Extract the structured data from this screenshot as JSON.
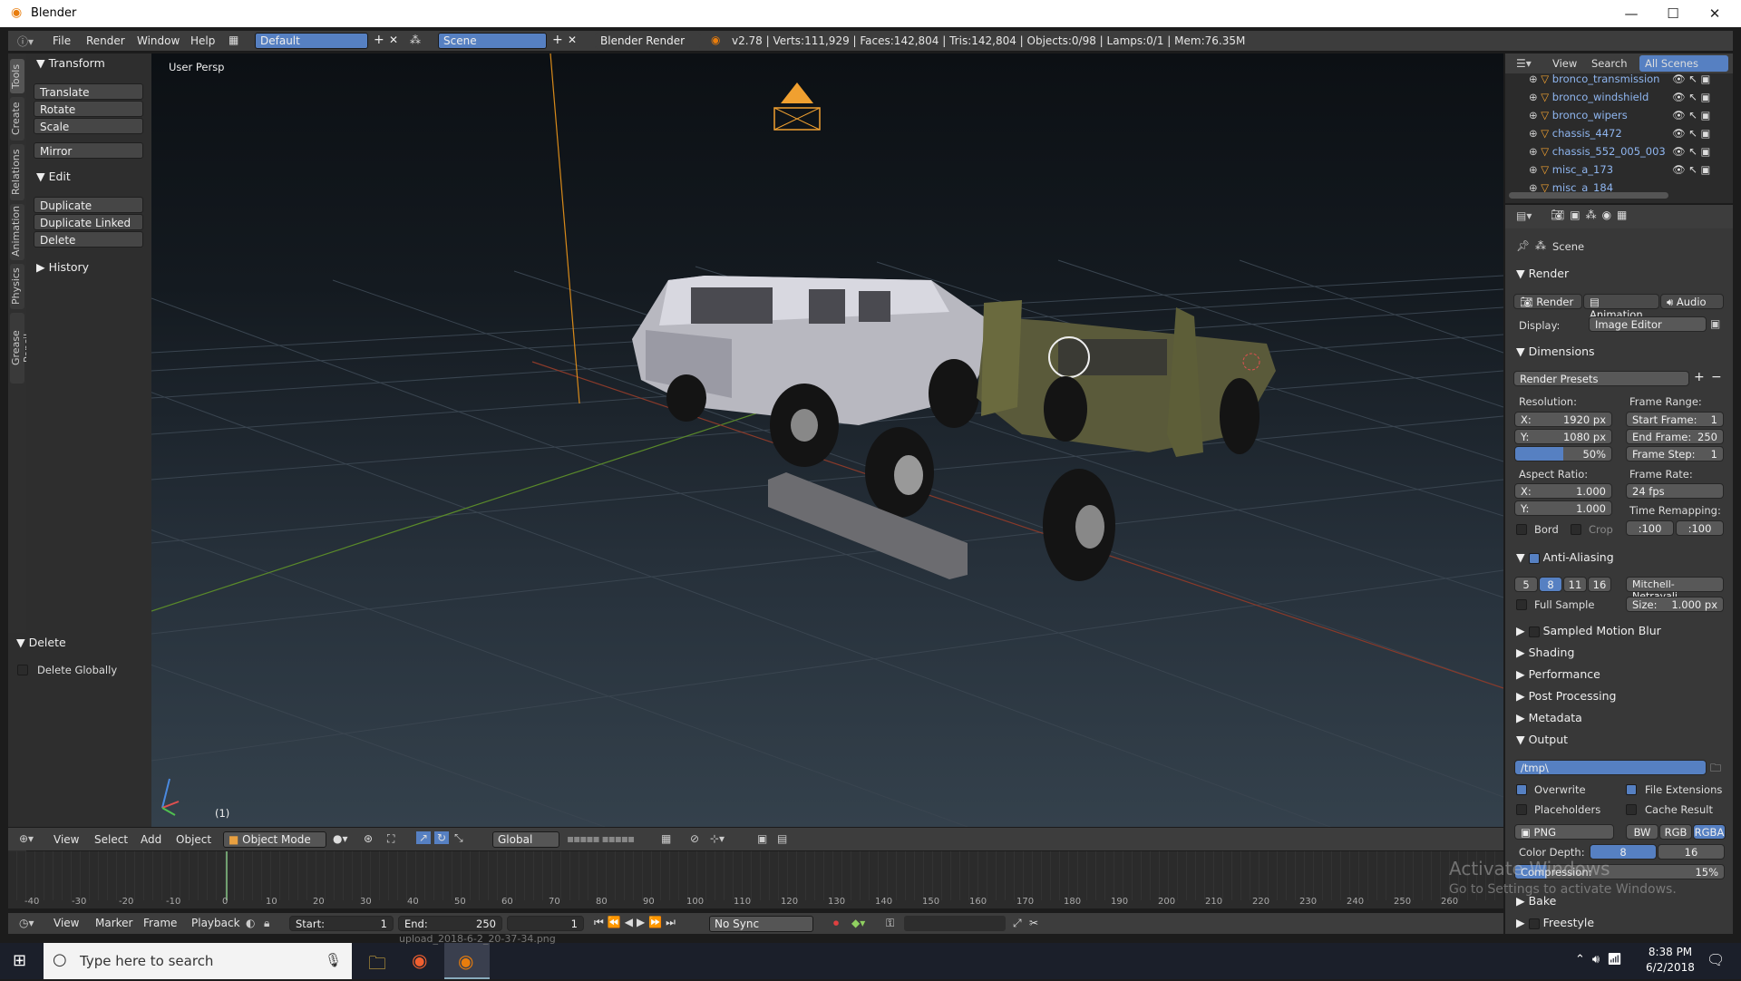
{
  "window": {
    "title": "Blender",
    "minimize": "—",
    "maximize": "☐",
    "close": "✕"
  },
  "infobar": {
    "menus": [
      "File",
      "Render",
      "Window",
      "Help"
    ],
    "layout": "Default",
    "scene": "Scene",
    "engine": "Blender Render",
    "stats": "v2.78 | Verts:111,929 | Faces:142,804 | Tris:142,804 | Objects:0/98 | Lamps:0/1 | Mem:76.35M"
  },
  "vtabs": [
    "Tools",
    "Create",
    "Relations",
    "Animation",
    "Physics",
    "Grease Pencil"
  ],
  "toolshelf": {
    "transform": {
      "header": "Transform",
      "items": [
        "Translate",
        "Rotate",
        "Scale",
        "Mirror"
      ]
    },
    "edit": {
      "header": "Edit",
      "items": [
        "Duplicate",
        "Duplicate Linked",
        "Delete"
      ]
    },
    "history": "History",
    "delete_panel": {
      "header": "Delete",
      "checkbox": "Delete Globally"
    }
  },
  "viewport": {
    "label": "User Persp",
    "frame_label": "(1)"
  },
  "vpheader": {
    "items": [
      "View",
      "Select",
      "Add",
      "Object"
    ],
    "mode": "Object Mode",
    "orientation": "Global"
  },
  "timeline": {
    "ticks": [
      "-40",
      "-30",
      "-20",
      "-10",
      "0",
      "10",
      "20",
      "30",
      "40",
      "50",
      "60",
      "70",
      "80",
      "90",
      "100",
      "110",
      "120",
      "130",
      "140",
      "150",
      "160",
      "170",
      "180",
      "190",
      "200",
      "210",
      "220",
      "230",
      "240",
      "250",
      "260"
    ],
    "menus": [
      "View",
      "Marker",
      "Frame",
      "Playback"
    ],
    "start_label": "Start:",
    "start": "1",
    "end_label": "End:",
    "end": "250",
    "current": "1",
    "sync": "No Sync"
  },
  "outliner": {
    "menus": [
      "View",
      "Search",
      "All Scenes"
    ],
    "rows": [
      "bronco_transmission",
      "bronco_windshield",
      "bronco_wipers",
      "chassis_4472",
      "chassis_552_005_003",
      "misc_a_173",
      "misc_a_184"
    ]
  },
  "properties": {
    "context": "Scene",
    "render": {
      "header": "Render",
      "buttons": [
        "Render",
        "Animation",
        "Audio"
      ],
      "display_label": "Display:",
      "display": "Image Editor"
    },
    "dimensions": {
      "header": "Dimensions",
      "presets": "Render Presets",
      "resolution_label": "Resolution:",
      "res_x": "1920 px",
      "res_y": "1080 px",
      "res_pct": "50%",
      "frame_range_label": "Frame Range:",
      "start_frame": "Start Frame:",
      "start_val": "1",
      "end_frame": "End Frame:",
      "end_val": "250",
      "frame_step": "Frame Step:",
      "step_val": "1",
      "aspect_label": "Aspect Ratio:",
      "asp_x": "1.000",
      "asp_y": "1.000",
      "frame_rate_label": "Frame Rate:",
      "frame_rate": "24 fps",
      "remap_label": "Time Remapping:",
      "remap_old": ":100",
      "remap_new": ":100",
      "bord": "Bord",
      "crop": "Crop",
      "x": "X:",
      "y": "Y:"
    },
    "aa": {
      "header": "Anti-Aliasing",
      "samples": [
        "5",
        "8",
        "11",
        "16"
      ],
      "filter": "Mitchell-Netravali",
      "full_sample": "Full Sample",
      "size_label": "Size:",
      "size": "1.000 px"
    },
    "collapsed": [
      "Sampled Motion Blur",
      "Shading",
      "Performance",
      "Post Processing",
      "Metadata"
    ],
    "output": {
      "header": "Output",
      "path": "/tmp\\",
      "overwrite": "Overwrite",
      "file_ext": "File Extensions",
      "placeholders": "Placeholders",
      "cache": "Cache Result",
      "format": "PNG",
      "bw": "BW",
      "rgb": "RGB",
      "rgba": "RGBA",
      "color_depth": "Color Depth:",
      "depth8": "8",
      "depth16": "16",
      "compression": "Compression:",
      "compression_val": "15%"
    },
    "bake": "Bake",
    "freestyle": "Freestyle"
  },
  "watermark": {
    "line1": "Activate Windows",
    "line2": "Go to Settings to activate Windows."
  },
  "taskbar": {
    "search": "Type here to search",
    "time": "8:38 PM",
    "date": "6/2/2018",
    "upload": "upload_2018-6-2_20-37-34.png"
  },
  "colors": {
    "accent": "#5680c2",
    "orange": "#e87d0d",
    "select": "#f0a030"
  }
}
